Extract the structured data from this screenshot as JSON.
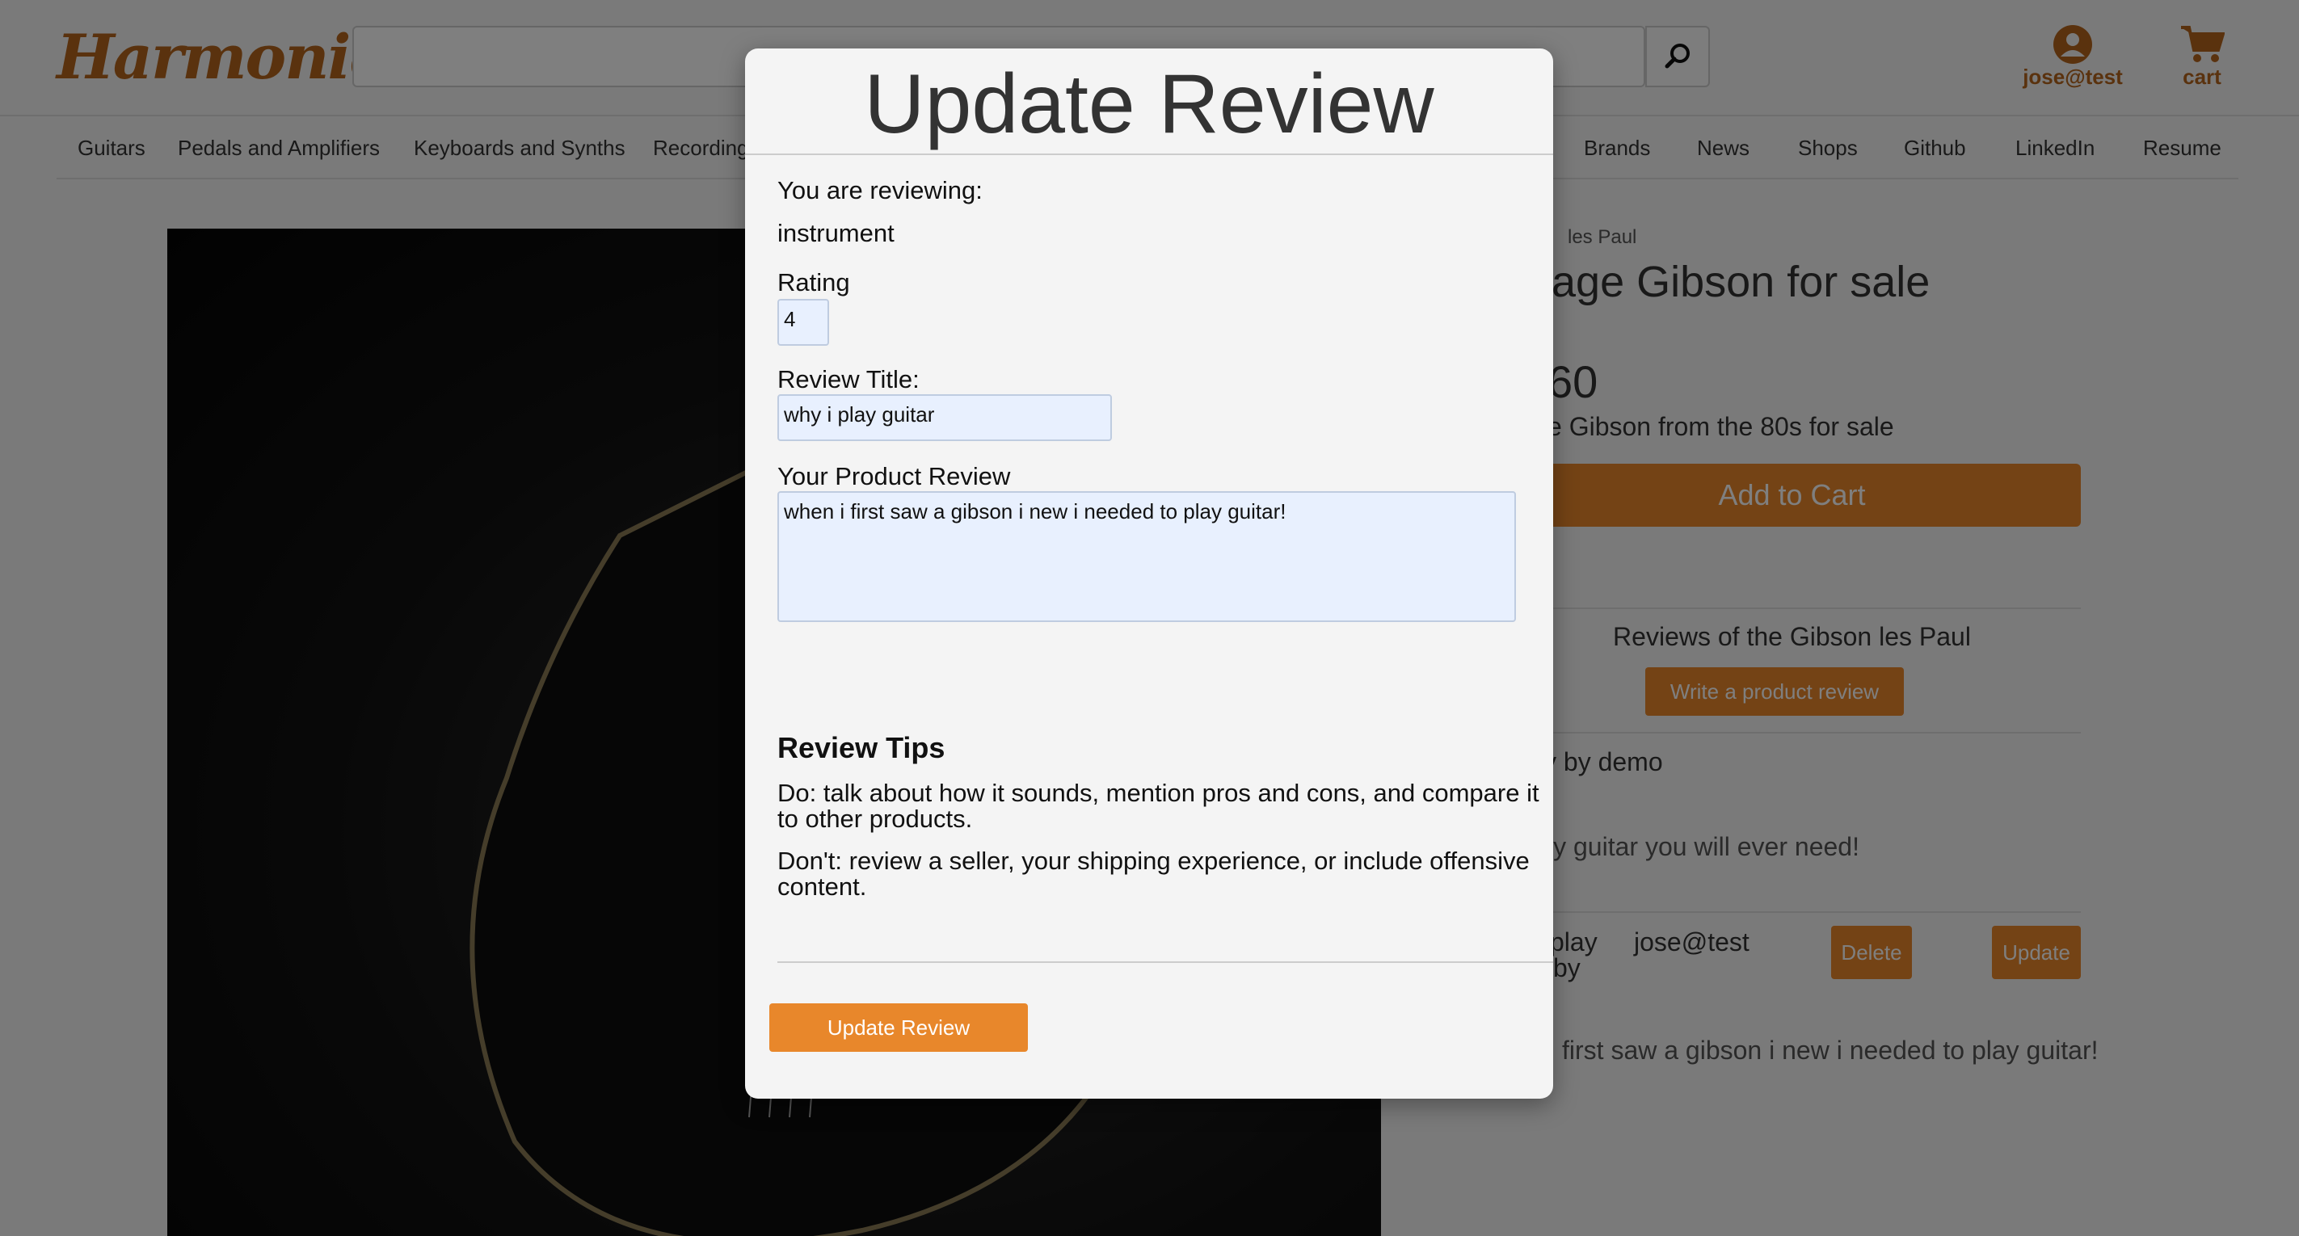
{
  "brand": "Harmonic",
  "header": {
    "account_label": "jose@test",
    "cart_label": "cart"
  },
  "nav": {
    "left": [
      "Guitars",
      "Pedals and Amplifiers",
      "Keyboards and Synths",
      "Recording"
    ],
    "right": [
      "Brands",
      "News",
      "Shops",
      "Github",
      "LinkedIn",
      "Resume"
    ]
  },
  "product": {
    "breadcrumb": "les Paul",
    "title": "age Gibson for sale",
    "price": "60",
    "subtitle": "e Gibson from the 80s for sale",
    "add_to_cart": "Add to Cart"
  },
  "reviews": {
    "heading": "Reviews of the Gibson les Paul",
    "write_button": "Write a product review",
    "items": [
      {
        "header": "y by demo",
        "body": "ly guitar you will ever need!"
      },
      {
        "header_a": "play",
        "header_b": "by",
        "author": "jose@test",
        "delete": "Delete",
        "update": "Update",
        "body": "first saw a gibson i new i needed to play guitar!"
      }
    ]
  },
  "modal": {
    "title": "Update Review",
    "reviewing_label": "You are reviewing:",
    "reviewing_value": "instrument",
    "rating_label": "Rating",
    "rating_value": "4",
    "title_label": "Review Title:",
    "title_value": "why i play guitar",
    "review_label": "Your Product Review",
    "review_value": "when i first saw a gibson i new i needed to play guitar!",
    "tips_heading": "Review Tips",
    "tip_do": "Do: talk about how it sounds, mention pros and cons, and compare it to other products.",
    "tip_dont": "Don't: review a seller, your shipping experience, or include offensive content.",
    "submit_label": "Update Review"
  },
  "colors": {
    "accent": "#e8872b",
    "brand": "#b5651d",
    "input_bg": "#e8f0fe"
  },
  "icons": {
    "search": "search-icon",
    "account": "user-circle-icon",
    "cart": "cart-icon"
  }
}
